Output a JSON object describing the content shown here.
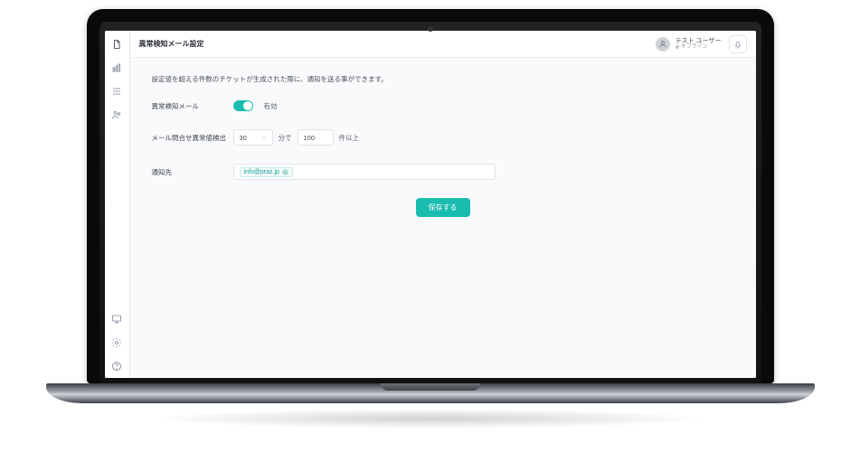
{
  "header": {
    "title": "異常検知メール設定",
    "user": {
      "name": "テスト ユーザー",
      "status": "オフライン"
    }
  },
  "content": {
    "lead": "設定値を超える件数のチケットが生成された際に、通知を送る事ができます。",
    "fields": {
      "enable_label": "異常検知メール",
      "enable_state": "有効",
      "threshold_label": "メール問合せ異常値検出",
      "threshold_interval": "30",
      "threshold_unit": "分で",
      "threshold_count": "100",
      "threshold_suffix": "件以上",
      "recipients_label": "通知先",
      "recipient_tag": "info@praz.jp"
    },
    "save_button": "保存する"
  },
  "colors": {
    "accent": "#1abcb0"
  }
}
